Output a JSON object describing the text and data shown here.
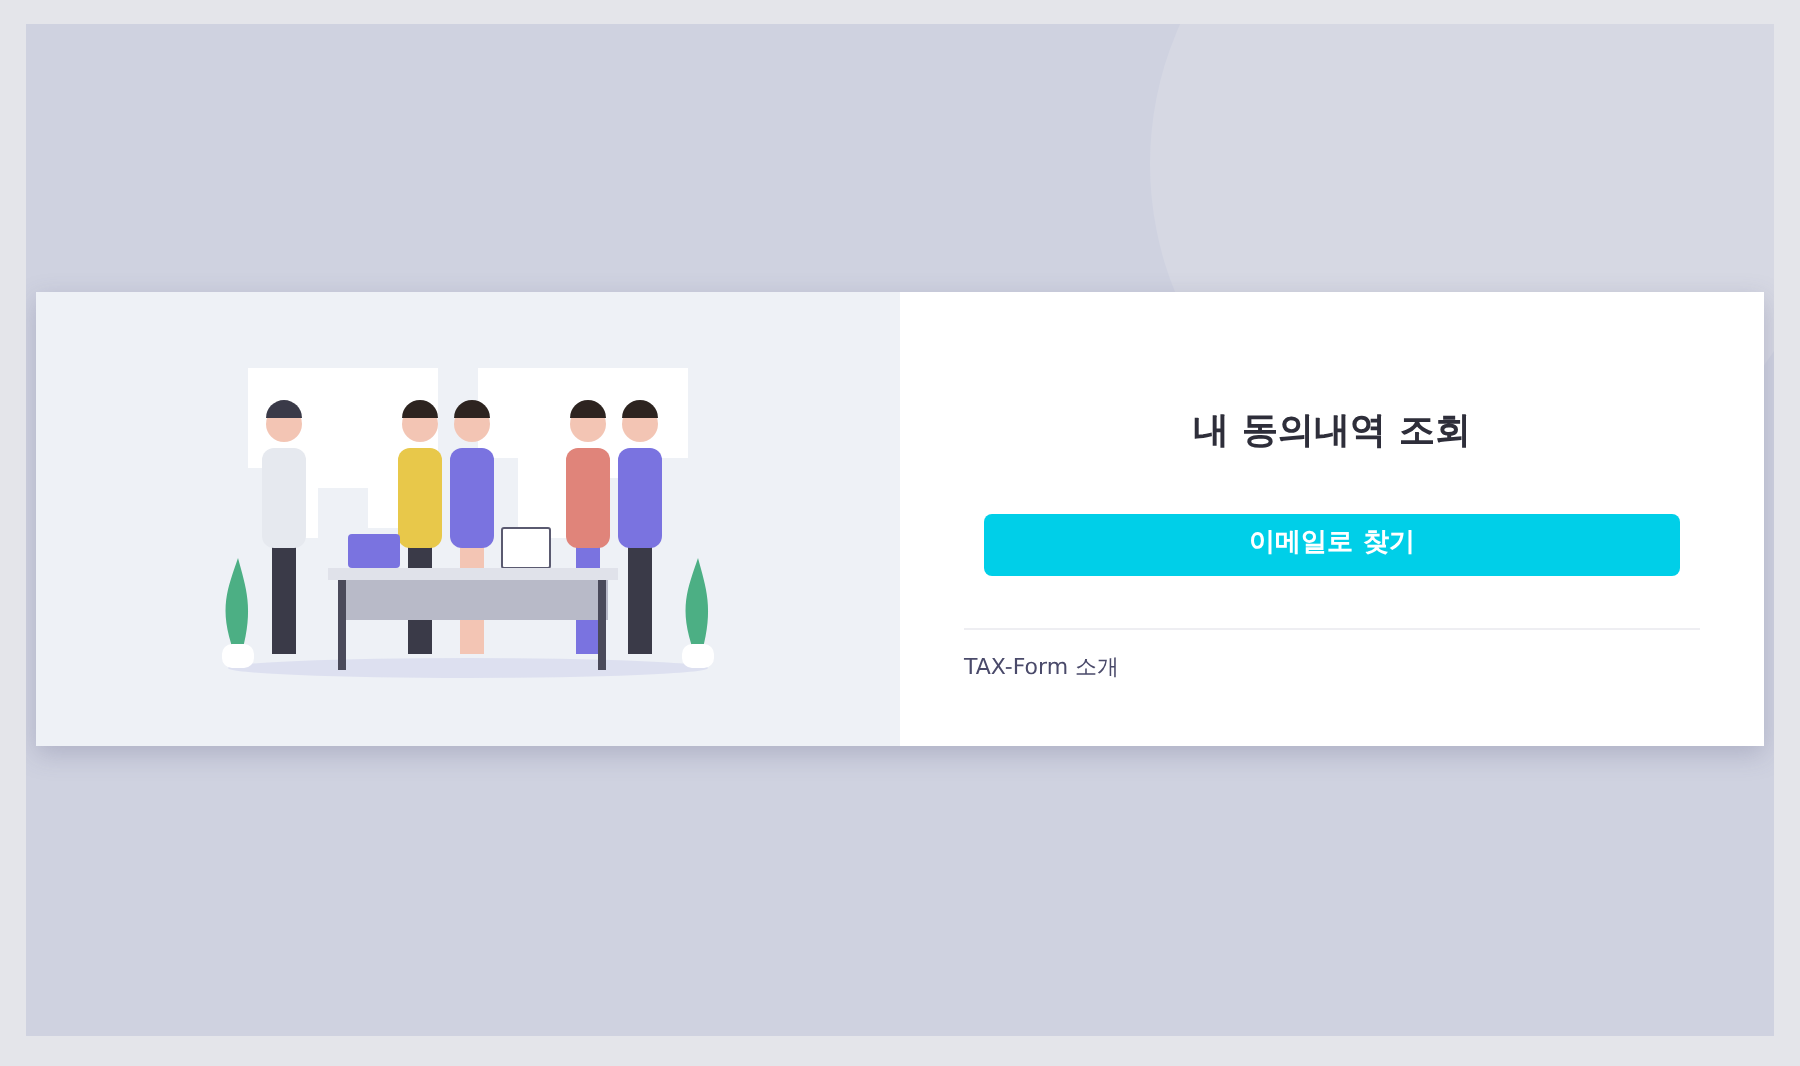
{
  "title": "내 동의내역 조회",
  "email_button": {
    "label": "이메일로 찾기"
  },
  "intro_link": {
    "label": "TAX-Form 소개"
  }
}
